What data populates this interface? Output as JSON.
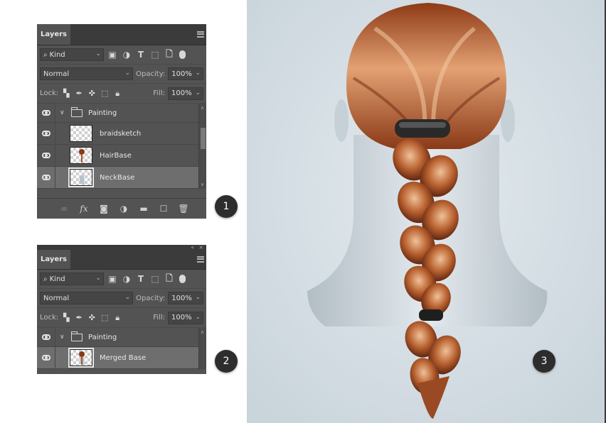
{
  "panel1": {
    "tab_label": "Layers",
    "kind_filter": "Kind",
    "blend_mode": "Normal",
    "opacity_label": "Opacity:",
    "opacity_value": "100%",
    "lock_label": "Lock:",
    "fill_label": "Fill:",
    "fill_value": "100%",
    "group_name": "Painting",
    "layers": [
      "braidsketch",
      "HairBase",
      "NeckBase"
    ],
    "selected_layer": "NeckBase"
  },
  "panel2": {
    "tab_label": "Layers",
    "kind_filter": "Kind",
    "blend_mode": "Normal",
    "opacity_label": "Opacity:",
    "opacity_value": "100%",
    "lock_label": "Lock:",
    "fill_label": "Fill:",
    "fill_value": "100%",
    "group_name": "Painting",
    "layers": [
      "Merged Base"
    ],
    "selected_layer": "Merged Base"
  },
  "steps": [
    "1",
    "2",
    "3"
  ],
  "icons": {
    "filters": [
      "image-filter-icon",
      "adjustment-filter-icon",
      "type-filter-icon",
      "shape-filter-icon",
      "smart-object-filter-icon"
    ],
    "locks": [
      "lock-transparent-pixels-icon",
      "lock-image-pixels-icon",
      "lock-position-icon",
      "lock-artboard-icon",
      "lock-all-icon"
    ],
    "bottom": [
      "link-layers-icon",
      "layer-style-fx-icon",
      "add-mask-icon",
      "adjustment-layer-icon",
      "new-group-icon",
      "new-layer-icon",
      "delete-layer-icon"
    ]
  },
  "colors": {
    "panel_bg": "#535353",
    "panel_dark": "#3b3b3b",
    "selected_row": "#6e6e6e",
    "canvas_bg": "#d5dfe5",
    "hair_dark": "#6b2a12",
    "hair_mid": "#a8552a",
    "hair_light": "#e2a173",
    "neck": "#c5cfd6"
  }
}
